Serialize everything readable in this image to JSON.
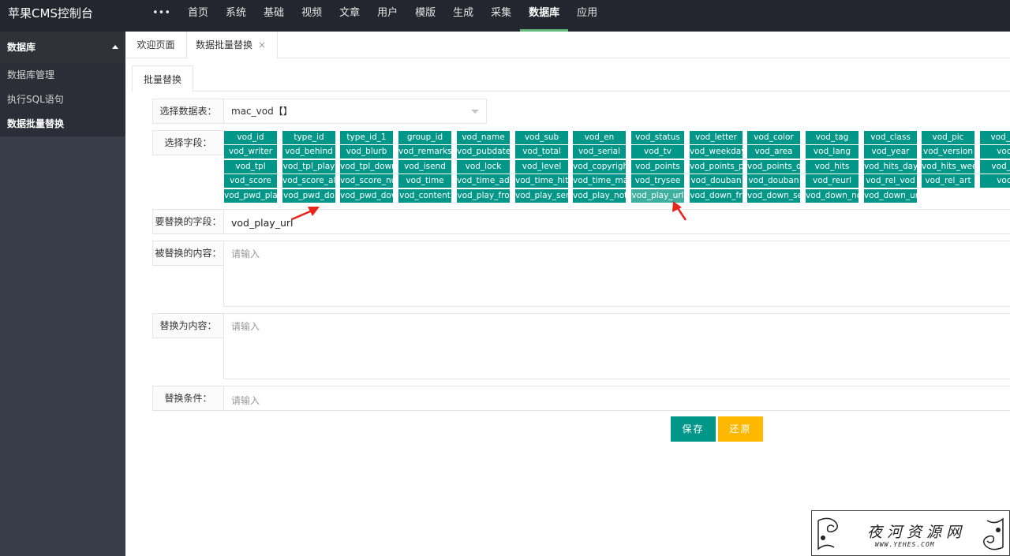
{
  "app": {
    "title": "苹果CMS控制台"
  },
  "topnav": {
    "items": [
      {
        "label": "•••"
      },
      {
        "label": "首页"
      },
      {
        "label": "系统"
      },
      {
        "label": "基础"
      },
      {
        "label": "视频"
      },
      {
        "label": "文章"
      },
      {
        "label": "用户"
      },
      {
        "label": "模版"
      },
      {
        "label": "生成"
      },
      {
        "label": "采集"
      },
      {
        "label": "数据库"
      },
      {
        "label": "应用"
      }
    ],
    "active": "数据库"
  },
  "sidebar": {
    "heading": "数据库",
    "items": [
      {
        "label": "数据库管理"
      },
      {
        "label": "执行SQL语句"
      },
      {
        "label": "数据批量替换"
      }
    ]
  },
  "tabs": {
    "home": "欢迎页面",
    "current": "数据批量替换",
    "close_glyph": "×"
  },
  "inner_tab": "批量替换",
  "form": {
    "table_label": "选择数据表：",
    "table_value": "mac_vod【】",
    "fields_label": "选择字段：",
    "replace_field_label": "要替换的字段：",
    "replace_field_value": "vod_play_url",
    "find_label": "被替换的内容：",
    "find_placeholder": "请输入",
    "replace_label": "替换为内容：",
    "replace_placeholder": "请输入",
    "condition_label": "替换条件：",
    "condition_placeholder": "请输入",
    "save": "保存",
    "reset": "还原"
  },
  "field_rows": [
    [
      "vod_id",
      "type_id",
      "type_id_1",
      "group_id",
      "vod_name",
      "vod_sub",
      "vod_en",
      "vod_status",
      "vod_letter",
      "vod_color",
      "vod_tag",
      "vod_class",
      "vod_pic",
      "vod_pic"
    ],
    [
      "vod_writer",
      "vod_behind",
      "vod_blurb",
      "vod_remarks",
      "vod_pubdate",
      "vod_total",
      "vod_serial",
      "vod_tv",
      "vod_weekday",
      "vod_area",
      "vod_lang",
      "vod_year",
      "vod_version",
      "vod_"
    ],
    [
      "vod_tpl",
      "vod_tpl_play",
      "vod_tpl_down",
      "vod_isend",
      "vod_lock",
      "vod_level",
      "vod_copyright",
      "vod_points",
      "vod_points_p",
      "vod_points_d",
      "vod_hits",
      "vod_hits_day",
      "vod_hits_wee",
      "vod_hit"
    ],
    [
      "vod_score",
      "vod_score_all",
      "vod_score_nu",
      "vod_time",
      "vod_time_add",
      "vod_time_hits",
      "vod_time_ma",
      "vod_trysee",
      "vod_douban",
      "vod_douban",
      "vod_reurl",
      "vod_rel_vod",
      "vod_rel_art",
      "vod_"
    ],
    [
      "vod_pwd_pla",
      "vod_pwd_do",
      "vod_pwd_dov",
      "vod_content",
      "vod_play_fro",
      "vod_play_ser",
      "vod_play_not",
      "vod_play_url",
      "vod_down_fr",
      "vod_down_se",
      "vod_down_no",
      "vod_down_ur"
    ]
  ],
  "selected_field": "vod_play_url",
  "watermark": {
    "title": "夜河资源网",
    "url": "WWW.YEHES.COM"
  }
}
